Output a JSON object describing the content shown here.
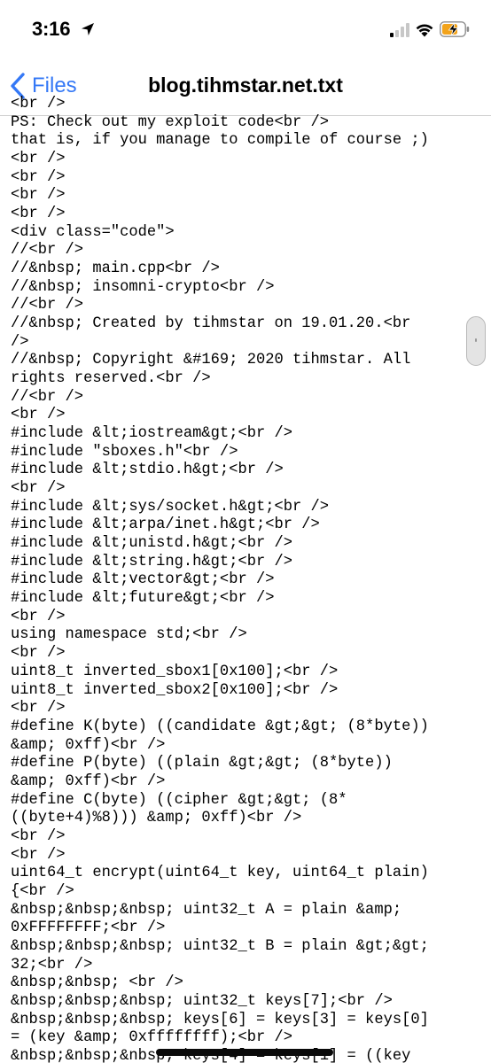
{
  "status_bar": {
    "time": "3:16",
    "location_icon": "location-arrow-icon",
    "signal_icon": "cellular-signal-icon",
    "wifi_icon": "wifi-icon",
    "battery_icon": "battery-charging-icon",
    "battery_color": "#f2a31b"
  },
  "nav": {
    "back_label": "Files",
    "back_icon": "chevron-left-icon",
    "title": "blog.tihmstar.net.txt",
    "accent_color": "#3478f6"
  },
  "document": {
    "lines": [
      "<br />",
      "PS: Check out my exploit code<br />",
      "that is, if you manage to compile of course ;)",
      "<br />",
      "<br />",
      "<br />",
      "<br />",
      "<div class=\"code\">",
      "//<br />",
      "//&nbsp; main.cpp<br />",
      "//&nbsp; insomni-crypto<br />",
      "//<br />",
      "//&nbsp; Created by tihmstar on 19.01.20.<br",
      "/>",
      "//&nbsp; Copyright &#169; 2020 tihmstar. All",
      "rights reserved.<br />",
      "//<br />",
      "<br />",
      "#include &lt;iostream&gt;<br />",
      "#include \"sboxes.h\"<br />",
      "#include &lt;stdio.h&gt;<br />",
      "<br />",
      "#include &lt;sys/socket.h&gt;<br />",
      "#include &lt;arpa/inet.h&gt;<br />",
      "#include &lt;unistd.h&gt;<br />",
      "#include &lt;string.h&gt;<br />",
      "#include &lt;vector&gt;<br />",
      "#include &lt;future&gt;<br />",
      "<br />",
      "using namespace std;<br />",
      "<br />",
      "uint8_t inverted_sbox1[0x100];<br />",
      "uint8_t inverted_sbox2[0x100];<br />",
      "<br />",
      "#define K(byte) ((candidate &gt;&gt; (8*byte))",
      "&amp; 0xff)<br />",
      "#define P(byte) ((plain &gt;&gt; (8*byte))",
      "&amp; 0xff)<br />",
      "#define C(byte) ((cipher &gt;&gt; (8*",
      "((byte+4)%8))) &amp; 0xff)<br />",
      "<br />",
      "<br />",
      "uint64_t encrypt(uint64_t key, uint64_t plain)",
      "{<br />",
      "&nbsp;&nbsp;&nbsp; uint32_t A = plain &amp;",
      "0xFFFFFFFF;<br />",
      "&nbsp;&nbsp;&nbsp; uint32_t B = plain &gt;&gt;",
      "32;<br />",
      "&nbsp;&nbsp; <br />",
      "&nbsp;&nbsp;&nbsp; uint32_t keys[7];<br />",
      "&nbsp;&nbsp;&nbsp; keys[6] = keys[3] = keys[0]",
      "= (key &amp; 0xffffffff);<br />",
      "&nbsp;&nbsp;&nbsp; keys[4] = keys[1] = ((key"
    ]
  }
}
